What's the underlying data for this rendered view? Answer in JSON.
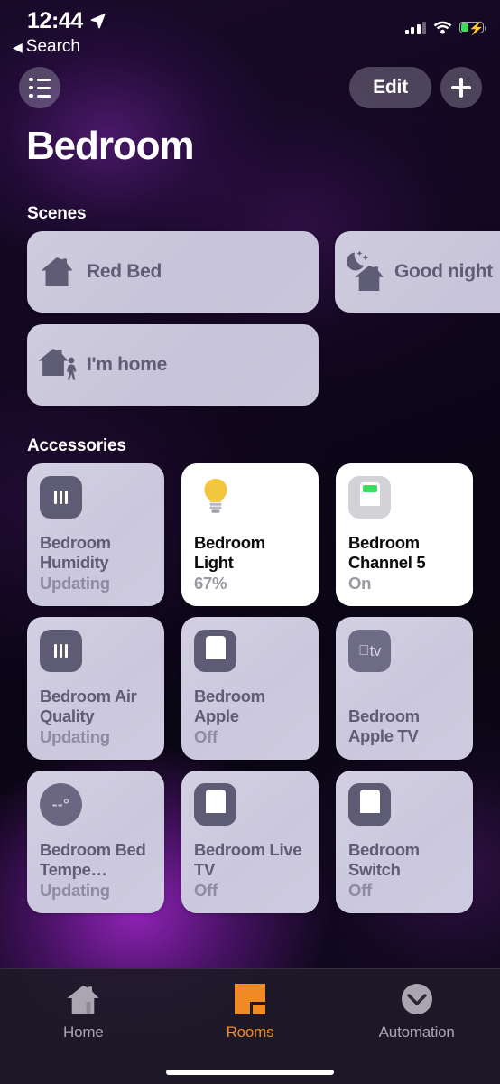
{
  "status_bar": {
    "time": "12:44",
    "location_icon": "location-arrow-icon",
    "back_label": "Search",
    "back_caret": "◀",
    "signal_icon": "cellular-signal-icon",
    "wifi_icon": "wifi-icon",
    "battery_icon": "battery-charging-icon",
    "battery_level_percent": 33
  },
  "nav": {
    "list_button_icon": "list-icon",
    "edit_label": "Edit",
    "add_button_icon": "plus-icon"
  },
  "page": {
    "title": "Bedroom"
  },
  "scenes": {
    "header": "Scenes",
    "items": [
      {
        "label": "Red Bed",
        "icon": "house-icon"
      },
      {
        "label": "Good night",
        "icon": "moon-stars-house-icon"
      },
      {
        "label": "I'm home",
        "icon": "house-person-icon"
      }
    ]
  },
  "accessories": {
    "header": "Accessories",
    "items": [
      {
        "name": "Bedroom Humidity",
        "status": "Updating",
        "icon": "humidity-sensor-icon",
        "state": "off"
      },
      {
        "name": "Bedroom Light",
        "status": "67%",
        "icon": "lightbulb-icon",
        "state": "on"
      },
      {
        "name": "Bedroom Channel 5",
        "status": "On",
        "icon": "switch-icon",
        "state": "on"
      },
      {
        "name": "Bedroom Air Quality",
        "status": "Updating",
        "icon": "air-quality-sensor-icon",
        "state": "off"
      },
      {
        "name": "Bedroom Apple",
        "status": "Off",
        "icon": "switch-icon",
        "state": "off"
      },
      {
        "name": "Bedroom Apple TV",
        "status": "",
        "icon": "apple-tv-icon",
        "state": "off"
      },
      {
        "name": "Bedroom Bed Tempe…",
        "status": "Updating",
        "icon": "temperature-icon",
        "state": "off"
      },
      {
        "name": "Bedroom Live TV",
        "status": "Off",
        "icon": "switch-icon",
        "state": "off"
      },
      {
        "name": "Bedroom Switch",
        "status": "Off",
        "icon": "switch-icon",
        "state": "off"
      }
    ]
  },
  "tab_bar": {
    "tabs": [
      {
        "label": "Home",
        "icon": "house-icon",
        "active": false
      },
      {
        "label": "Rooms",
        "icon": "rooms-icon",
        "active": true
      },
      {
        "label": "Automation",
        "icon": "clock-check-icon",
        "active": false
      }
    ]
  },
  "colors": {
    "accent": "#f08a24",
    "tile_inactive": "#cbc8dd",
    "tile_active": "#ffffff",
    "icon_slate": "#5e5b75",
    "bulb_yellow": "#f3c63f",
    "battery_green": "#3ddc5c"
  }
}
